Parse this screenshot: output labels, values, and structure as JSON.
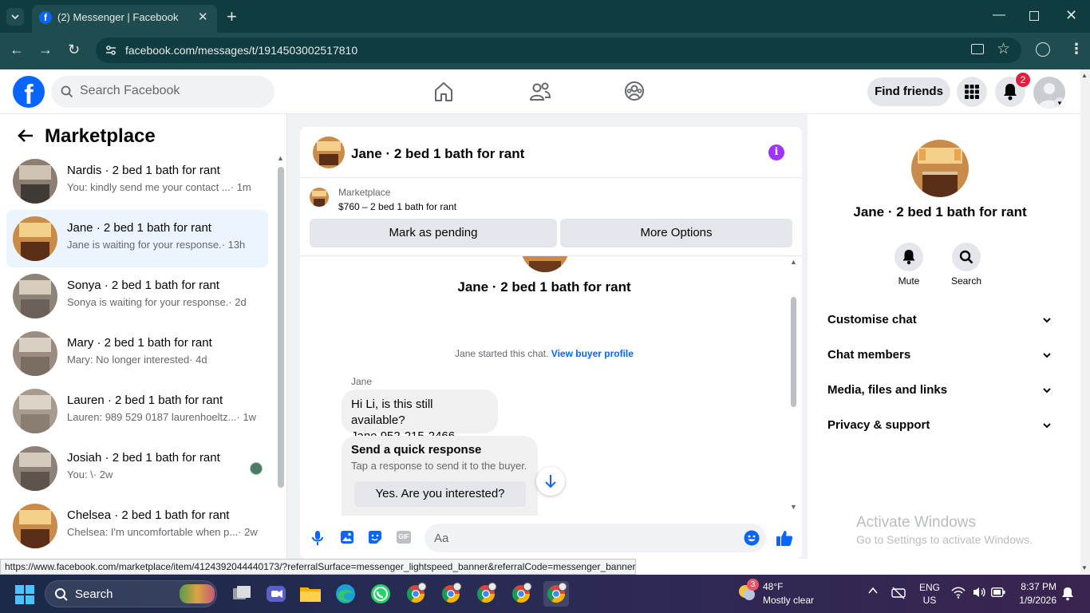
{
  "browser": {
    "tab_title": "(2) Messenger | Facebook",
    "url": "facebook.com/messages/t/1914503002517810",
    "hover_url": "https://www.facebook.com/marketplace/item/4124392044440173/?referralSurface=messenger_lightspeed_banner&referralCode=messenger_banner"
  },
  "header": {
    "search_placeholder": "Search Facebook",
    "find_friends": "Find friends",
    "notification_count": "2"
  },
  "left": {
    "title": "Marketplace",
    "conversations": [
      {
        "title": "Nardis · 2 bed 1 bath for rant",
        "preview": "You: kindly send me your contact ...",
        "time": "· 1m",
        "active": false
      },
      {
        "title": "Jane · 2 bed 1 bath for rant",
        "preview": "Jane is waiting for your response.",
        "time": "· 13h",
        "active": true
      },
      {
        "title": "Sonya · 2 bed 1 bath for rant",
        "preview": "Sonya is waiting for your response.",
        "time": "· 2d",
        "active": false
      },
      {
        "title": "Mary · 2 bed 1 bath for rant",
        "preview": "Mary: No longer interested",
        "time": "· 4d",
        "active": false
      },
      {
        "title": "Lauren · 2 bed 1 bath for rant",
        "preview": "Lauren: 989 529 0187 laurenhoeltz...",
        "time": "· 1w",
        "active": false
      },
      {
        "title": "Josiah · 2 bed 1 bath for rant",
        "preview": "You: \\",
        "time": "· 2w",
        "active": false
      },
      {
        "title": "Chelsea · 2 bed 1 bath for rant",
        "preview": "Chelsea: I'm uncomfortable when p...",
        "time": "· 2w",
        "active": false
      }
    ]
  },
  "chat": {
    "header_title": "Jane · 2 bed 1 bath for rant",
    "listing_source": "Marketplace",
    "listing_price_title": "$760 – 2 bed 1 bath for rant",
    "mark_pending": "Mark as pending",
    "more_options": "More Options",
    "profile_name": "Jane · 2 bed 1 bath for rant",
    "started_text": "Jane started this chat.",
    "view_buyer": "View buyer profile",
    "sender": "Jane",
    "message_line1": "Hi Li, is this still available?",
    "message_line2": "Jane 952-215-2466",
    "quick_title": "Send a quick response",
    "quick_sub": "Tap a response to send it to the buyer.",
    "quick_option": "Yes. Are you interested?",
    "input_placeholder": "Aa"
  },
  "right": {
    "name": "Jane · 2 bed 1 bath for rant",
    "mute": "Mute",
    "search": "Search",
    "sections": [
      "Customise chat",
      "Chat members",
      "Media, files and links",
      "Privacy & support"
    ],
    "watermark_title": "Activate Windows",
    "watermark_sub": "Go to Settings to activate Windows."
  },
  "taskbar": {
    "search": "Search",
    "weather_temp": "48°F",
    "weather_desc": "Mostly clear",
    "weather_badge": "3",
    "lang1": "ENG",
    "lang2": "US",
    "time": "8:37 PM",
    "date": "1/9/2026"
  },
  "colors": {
    "fb_blue": "#0866ff",
    "purple": "#a033ff",
    "active_row": "#ebf5ff",
    "red": "#e41e3f"
  }
}
